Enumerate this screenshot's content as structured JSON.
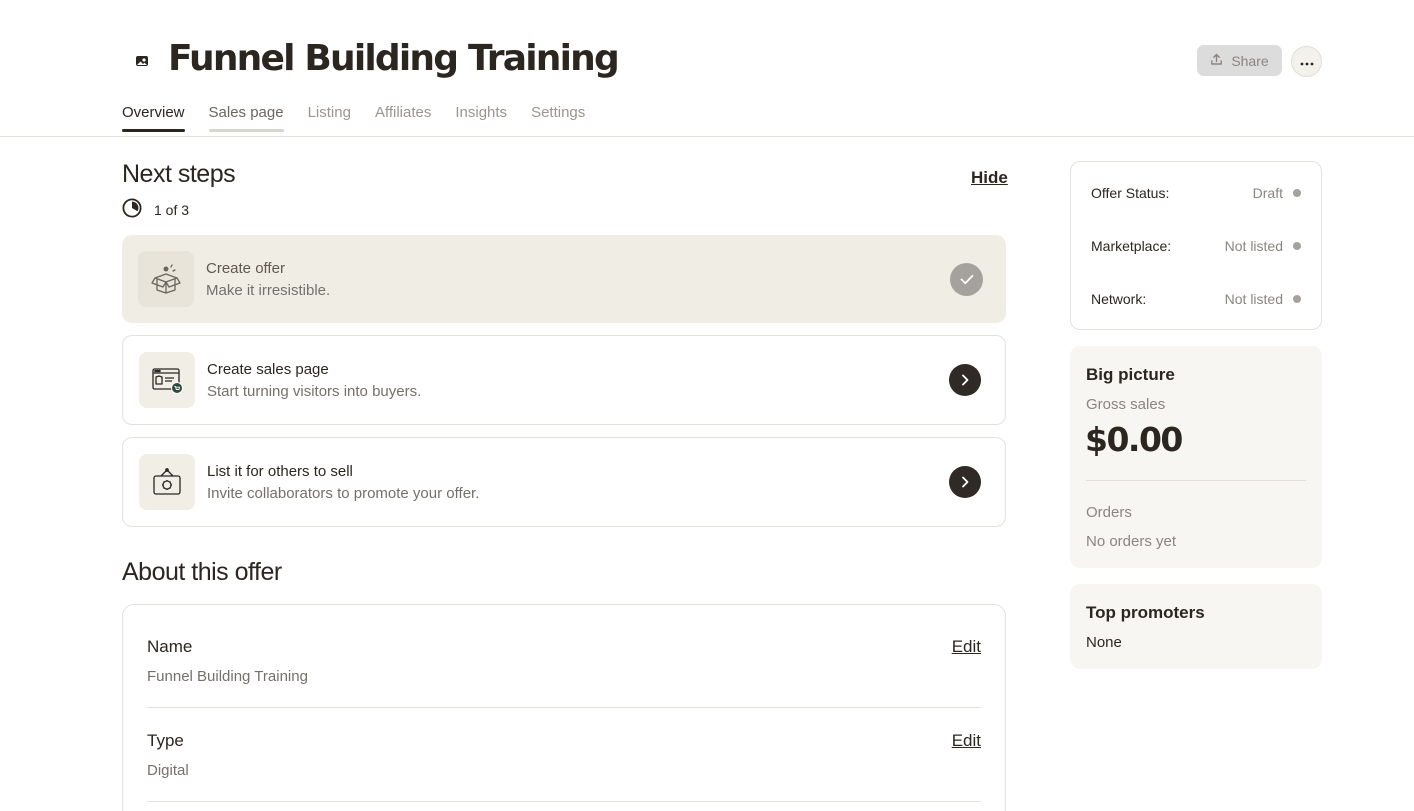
{
  "header": {
    "title": "Funnel Building Training",
    "title_icon": "image-icon",
    "share_label": "Share",
    "more_icon": "ellipsis-icon"
  },
  "tabs": [
    {
      "label": "Overview",
      "active": true
    },
    {
      "label": "Sales page",
      "active": false
    },
    {
      "label": "Listing",
      "active": false
    },
    {
      "label": "Affiliates",
      "active": false
    },
    {
      "label": "Insights",
      "active": false
    },
    {
      "label": "Settings",
      "active": false
    }
  ],
  "next_steps": {
    "title": "Next steps",
    "hide_label": "Hide",
    "progress_text": "1 of 3",
    "progress_fraction": 0.333,
    "steps": [
      {
        "title": "Create offer",
        "subtitle": "Make it irresistible.",
        "status": "done",
        "icon": "open-box-icon"
      },
      {
        "title": "Create sales page",
        "subtitle": "Start turning visitors into buyers.",
        "status": "todo",
        "icon": "sales-page-icon"
      },
      {
        "title": "List it for others to sell",
        "subtitle": "Invite collaborators to promote your offer.",
        "status": "todo",
        "icon": "marketplace-sign-icon"
      }
    ]
  },
  "about": {
    "title": "About this offer",
    "fields": [
      {
        "label": "Name",
        "value": "Funnel Building Training",
        "edit_label": "Edit"
      },
      {
        "label": "Type",
        "value": "Digital",
        "edit_label": "Edit"
      }
    ]
  },
  "status": {
    "rows": [
      {
        "label": "Offer Status:",
        "value": "Draft"
      },
      {
        "label": "Marketplace:",
        "value": "Not listed"
      },
      {
        "label": "Network:",
        "value": "Not listed"
      }
    ],
    "dot_color": "#a5a29e"
  },
  "big_picture": {
    "title": "Big picture",
    "gross_label": "Gross sales",
    "gross_value": "$0.00",
    "orders_label": "Orders",
    "orders_value": "No orders yet"
  },
  "top_promoters": {
    "title": "Top promoters",
    "value": "None"
  },
  "colors": {
    "ink": "#2b2620",
    "muted": "#75706a",
    "done_bg": "#f0ede5",
    "card_bg": "#f8f6f2",
    "share_bg": "#dcdcdc"
  }
}
